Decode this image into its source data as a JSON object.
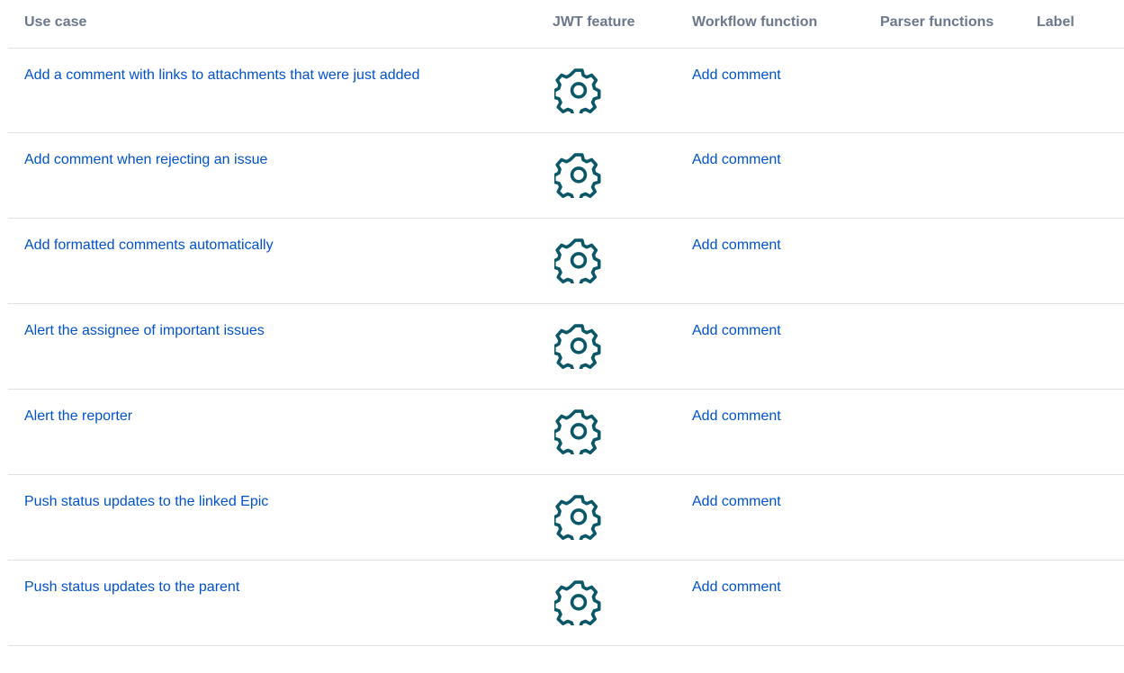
{
  "table": {
    "headers": {
      "use_case": "Use case",
      "jwt_feature": "JWT feature",
      "workflow_function": "Workflow function",
      "parser_functions": "Parser functions",
      "label": "Label"
    },
    "rows": [
      {
        "use_case": "Add a comment with links to attachments that were just added",
        "feature_icon": "gear-icon",
        "workflow_function": "Add comment",
        "parser_functions": "",
        "label": ""
      },
      {
        "use_case": "Add comment when rejecting an issue",
        "feature_icon": "gear-icon",
        "workflow_function": "Add comment",
        "parser_functions": "",
        "label": ""
      },
      {
        "use_case": "Add formatted comments automatically",
        "feature_icon": "gear-icon",
        "workflow_function": "Add comment",
        "parser_functions": "",
        "label": ""
      },
      {
        "use_case": "Alert the assignee of important issues",
        "feature_icon": "gear-icon",
        "workflow_function": "Add comment",
        "parser_functions": "",
        "label": ""
      },
      {
        "use_case": "Alert the reporter",
        "feature_icon": "gear-icon",
        "workflow_function": "Add comment",
        "parser_functions": "",
        "label": ""
      },
      {
        "use_case": "Push status updates to the linked Epic",
        "feature_icon": "gear-icon",
        "workflow_function": "Add comment",
        "parser_functions": "",
        "label": ""
      },
      {
        "use_case": "Push status updates to the parent",
        "feature_icon": "gear-icon",
        "workflow_function": "Add comment",
        "parser_functions": "",
        "label": ""
      }
    ]
  },
  "colors": {
    "header_text": "#6b778c",
    "link": "#0052cc",
    "icon": "#0b5767",
    "divider": "#dfe1e6"
  }
}
